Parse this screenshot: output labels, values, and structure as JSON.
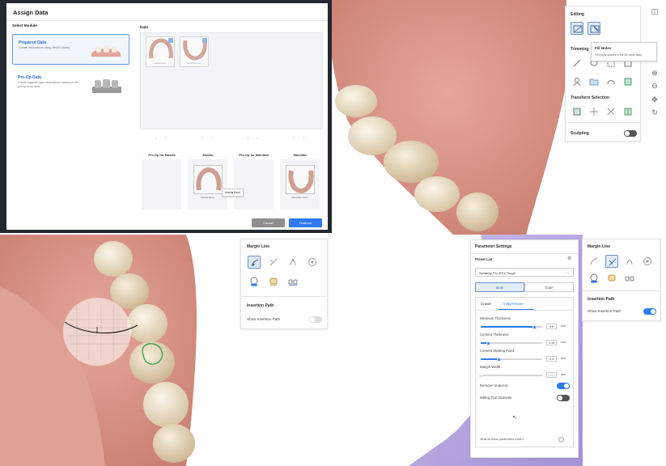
{
  "assign_dialog": {
    "title": "Assign Data",
    "select_module_label": "Select Module",
    "data_label": "Data",
    "modules": [
      {
        "title": "Prepared Data",
        "desc": "Create restorations using Medit's library."
      },
      {
        "title": "Pre-Op Data",
        "desc": "Create eggshell-type restorations based on the pre-op scan data."
      }
    ],
    "thumbnails": [
      {
        "caption": "Maxilla Base"
      },
      {
        "caption": "Mandible Base"
      }
    ],
    "slots": [
      {
        "label": "Pre-Op for Maxilla",
        "caption": ""
      },
      {
        "label": "Maxilla",
        "caption": "Maxilla Base"
      },
      {
        "label": "Pre-Op for Mandible",
        "caption": ""
      },
      {
        "label": "Mandible",
        "caption": "Mandible Base"
      }
    ],
    "tooltip": "Maxilla Base",
    "cancel_label": "Cancel",
    "finish_label": "Finished"
  },
  "editing_panel": {
    "title": "Editing",
    "trimming_label": "Trimming",
    "transform_label": "Transform Selection",
    "sculpting_label": "Sculpting",
    "sculpting_on": false,
    "tooltip_title": "Fill Holes",
    "tooltip_desc": "Fill empty spaces in the 3D mesh data."
  },
  "margin_panel_left": {
    "title": "Margin Line",
    "insertion_title": "Insertion Path",
    "show_insertion_label": "Show Insertion Path",
    "show_insertion_on": false
  },
  "margin_panel_right": {
    "title": "Margin Line",
    "insertion_title": "Insertion Path",
    "show_insertion_label": "Show Insertion Path",
    "show_insertion_on": true
  },
  "parameter_settings": {
    "title": "Parameter Settings",
    "preset_label": "Preset List",
    "preset_value": "Spiralray-Pro-DXX Tough",
    "segments": [
      "Inner",
      "Outer"
    ],
    "active_segment": "Inner",
    "tabs": [
      "Crown",
      "Inlay/Veneer"
    ],
    "active_tab": "Inlay/Veneer",
    "params": [
      {
        "label": "Minimum Thickness",
        "value": "0.6",
        "unit": "mm",
        "fraction": 0.88,
        "enabled": true
      },
      {
        "label": "Cement Thickness",
        "value": "0.15",
        "unit": "mm",
        "fraction": 0.12,
        "enabled": true
      },
      {
        "label": "Cement Starting Point",
        "value": "0.4",
        "unit": "mm",
        "fraction": 0.3,
        "enabled": true
      },
      {
        "label": "Margin Width",
        "value": "0.1",
        "unit": "mm",
        "fraction": 0.0,
        "enabled": false
      }
    ],
    "remove_undercut_label": "Remove Undercut",
    "remove_undercut_on": true,
    "milling_label": "Milling Tool Diameter",
    "milling_on": false,
    "help_text": "What do these parameters mean?",
    "help_icon": "?"
  },
  "view_icons": [
    "tooth-icon",
    "zoom-in-icon",
    "zoom-out-icon",
    "pan-icon",
    "rotate-icon"
  ],
  "colors": {
    "accent": "#2e7bf0",
    "gum": "#d9968a",
    "tooth": "#efe3cf",
    "purple_gum": "#b9a8df"
  }
}
